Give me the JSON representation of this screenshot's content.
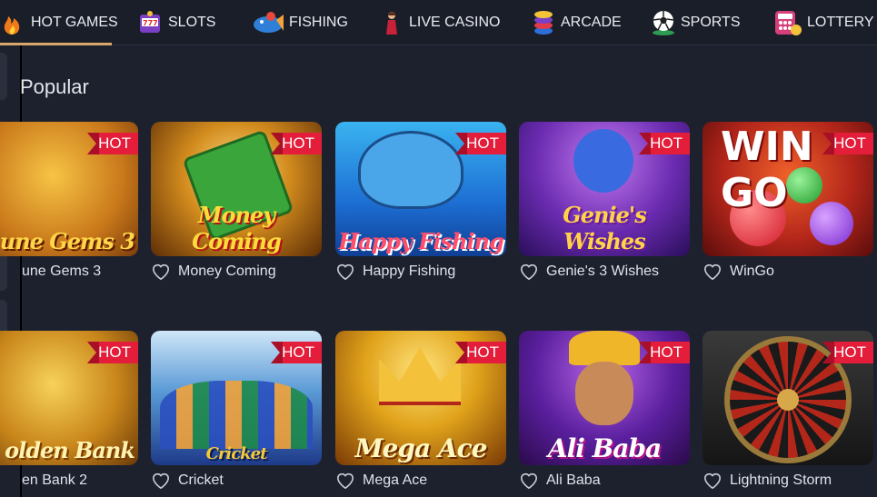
{
  "nav": {
    "items": [
      {
        "label": "HOT GAMES",
        "icon": "flame-icon",
        "active": true
      },
      {
        "label": "SLOTS",
        "icon": "slot-machine-icon"
      },
      {
        "label": "FISHING",
        "icon": "fishing-icon"
      },
      {
        "label": "LIVE CASINO",
        "icon": "dealer-icon"
      },
      {
        "label": "ARCADE",
        "icon": "chips-icon"
      },
      {
        "label": "SPORTS",
        "icon": "soccer-ball-icon"
      },
      {
        "label": "LOTTERY",
        "icon": "lottery-icon"
      }
    ],
    "accent": "#d9a76a"
  },
  "section": {
    "title": "Popular"
  },
  "badge_label": "HOT",
  "games_row1": [
    {
      "name": "une Gems 3",
      "art_text": "une Gems 3"
    },
    {
      "name": "Money Coming",
      "art_text": "Money Coming"
    },
    {
      "name": "Happy Fishing",
      "art_text": "Happy Fishing"
    },
    {
      "name": "Genie's 3 Wishes",
      "art_text": "Genie's Wishes"
    },
    {
      "name": "WinGo",
      "art_text": "WIN GO"
    }
  ],
  "games_row2": [
    {
      "name": "en Bank 2",
      "art_text": "olden Bank"
    },
    {
      "name": "Cricket",
      "art_text": "Cricket"
    },
    {
      "name": "Mega Ace",
      "art_text": "Mega Ace"
    },
    {
      "name": "Ali Baba",
      "art_text": "Ali Baba"
    },
    {
      "name": "Lightning Storm",
      "art_text": ""
    }
  ],
  "colors": {
    "background": "#1d212d",
    "hot_badge": "#e41d3a"
  }
}
